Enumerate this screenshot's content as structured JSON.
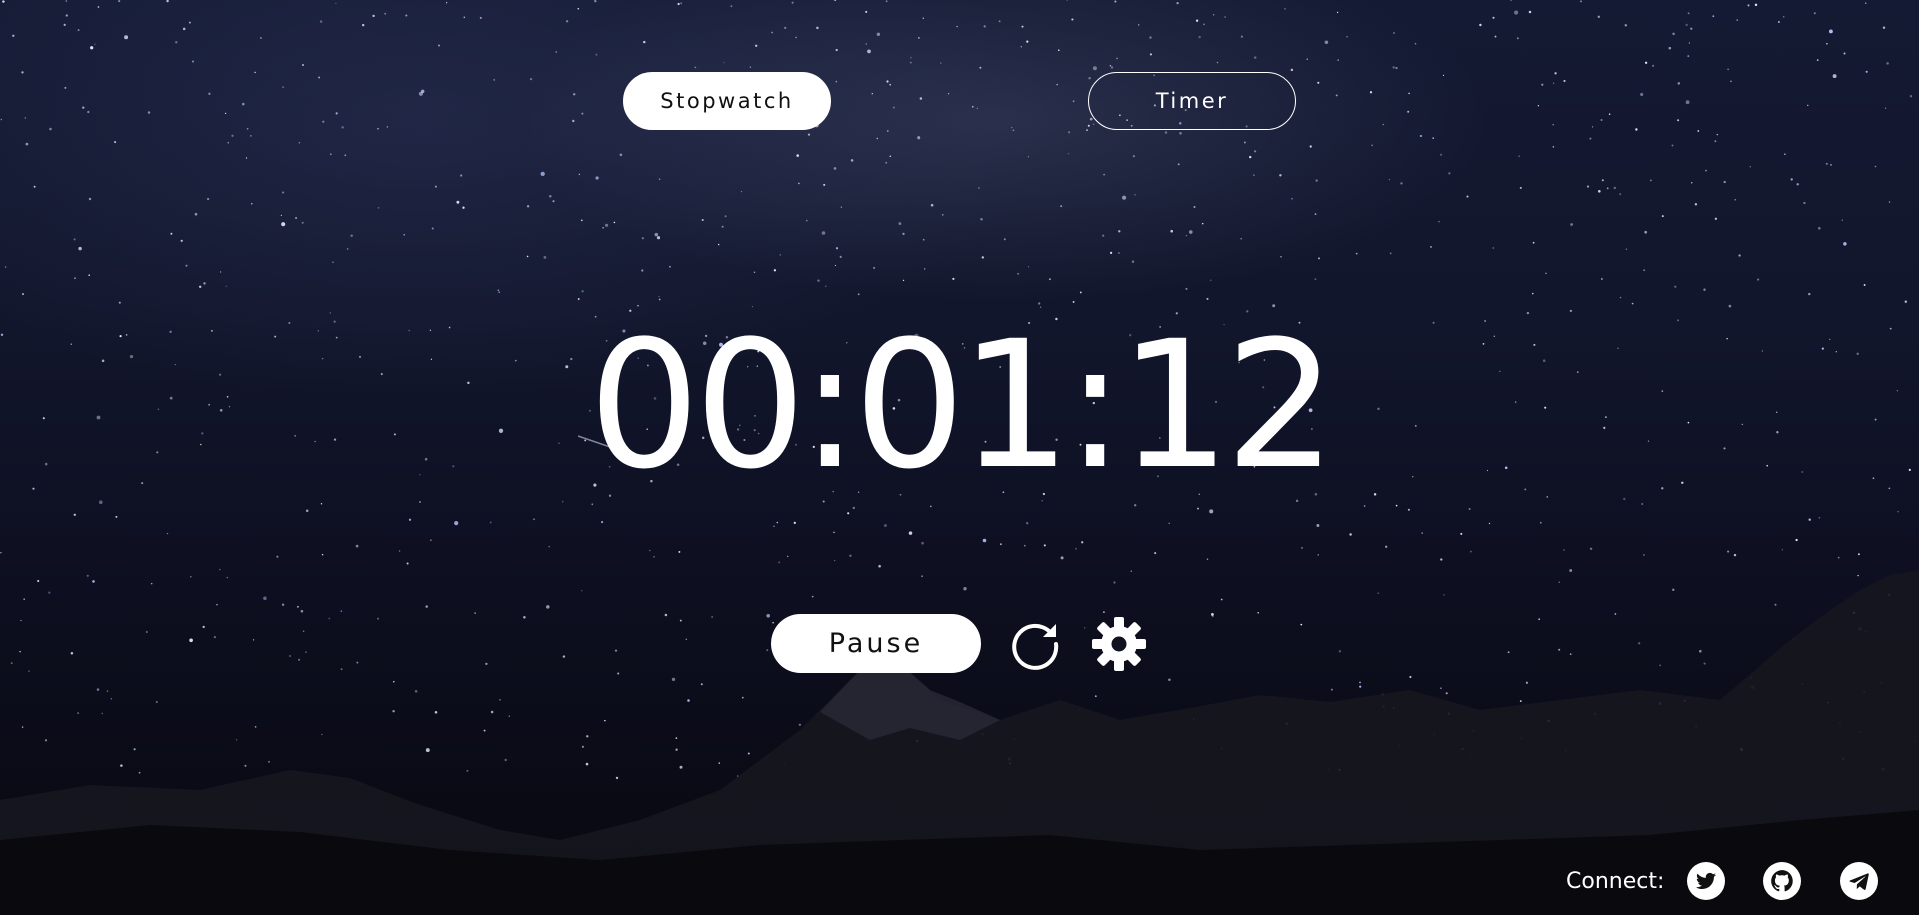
{
  "tabs": {
    "stopwatch_label": "Stopwatch",
    "timer_label": "Timer",
    "active": "Stopwatch"
  },
  "display": {
    "time": "00:01:12"
  },
  "controls": {
    "pause_label": "Pause",
    "reset_icon": "reset-icon",
    "settings_icon": "gear-icon"
  },
  "footer": {
    "connect_label": "Connect:",
    "socials": [
      "twitter-icon",
      "github-icon",
      "telegram-icon"
    ]
  },
  "colors": {
    "text": "#ffffff",
    "button_bg": "#ffffff",
    "button_text": "#111111"
  }
}
